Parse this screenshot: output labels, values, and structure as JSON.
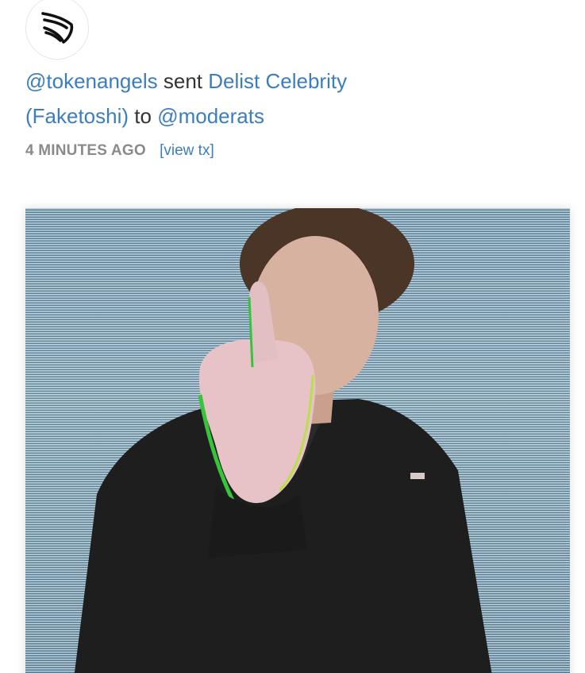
{
  "item": {
    "sender": "@tokenangels",
    "action": "sent",
    "nft_title_line1": "Delist Celebrity",
    "nft_title_line2": "(Faketoshi)",
    "connector": "to",
    "recipient": "@moderats",
    "time_ago": "4 MINUTES AGO",
    "view_tx": "[view tx]"
  },
  "icons": {
    "avatar": "winged-logo-icon"
  },
  "colors": {
    "link": "#3b7dbf",
    "text": "#333333",
    "meta": "#8a8a8a"
  }
}
